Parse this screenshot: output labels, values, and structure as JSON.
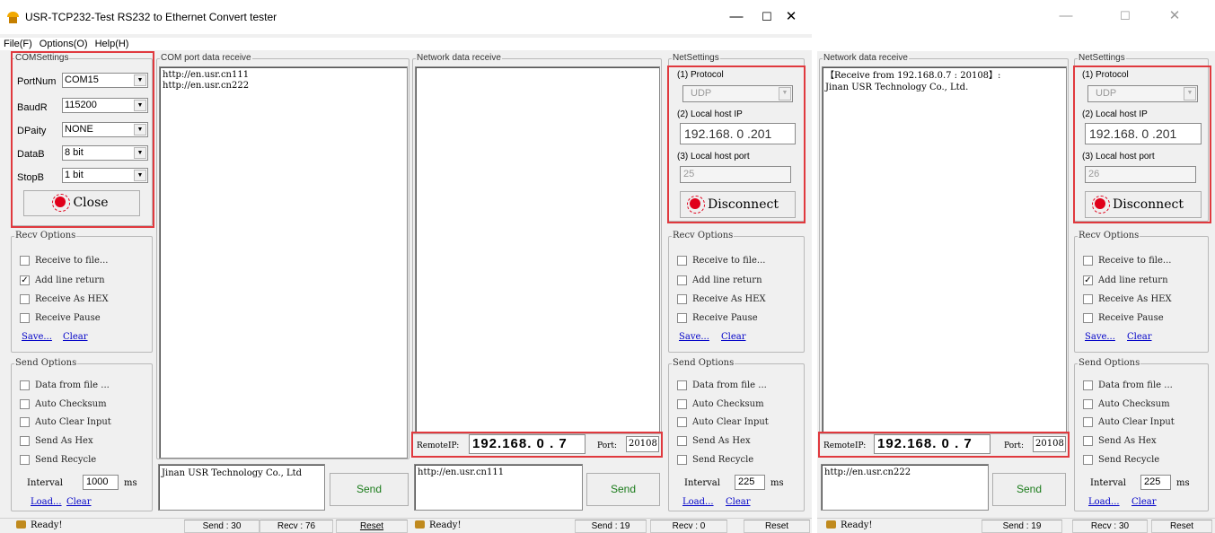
{
  "win1": {
    "title": "USR-TCP232-Test  RS232 to Ethernet Convert tester",
    "menu": [
      "File(F)",
      "Options(O)",
      "Help(H)"
    ],
    "com_settings": {
      "legend": "COMSettings",
      "port_label": "PortNum",
      "port_value": "COM15",
      "baud_label": "BaudR",
      "baud_value": "115200",
      "parity_label": "DPaity",
      "parity_value": "NONE",
      "data_label": "DataB",
      "data_value": "8 bit",
      "stop_label": "StopB",
      "stop_value": "1 bit",
      "close_btn": "Close"
    },
    "recv_options": {
      "legend": "Recv Options",
      "items": [
        "Receive to file...",
        "Add line return",
        "Receive As HEX",
        "Receive Pause"
      ],
      "checked": [
        false,
        true,
        false,
        false
      ],
      "save": "Save...",
      "clear": "Clear"
    },
    "send_options": {
      "legend": "Send Options",
      "items": [
        "Data from file ...",
        "Auto Checksum",
        "Auto Clear Input",
        "Send As Hex",
        "Send Recycle"
      ],
      "interval_label": "Interval",
      "interval_value": "1000",
      "interval_unit": "ms",
      "load": "Load...",
      "clear": "Clear"
    },
    "com_receive": {
      "legend": "COM port data receive",
      "lines": [
        "http://en.usr.cn111",
        "http://en.usr.cn222"
      ]
    },
    "com_send_text": "Jinan USR Technology Co., Ltd",
    "send_btn": "Send",
    "net_receive": {
      "legend": "Network data receive"
    },
    "remote_ip_label": "RemoteIP:",
    "remote_ip": "192.168. 0 . 7",
    "port_label": "Port:",
    "port_value": "20108",
    "net_send_text": "http://en.usr.cn111",
    "net_send_btn": "Send",
    "net_settings": {
      "legend": "NetSettings",
      "protocol_label": "(1) Protocol",
      "protocol": "UDP",
      "ip_label": "(2) Local host IP",
      "ip": "192.168. 0 .201",
      "port_label": "(3) Local host port",
      "port": "25",
      "disconnect": "Disconnect"
    },
    "net_recv_options": {
      "legend": "Recv Options",
      "items": [
        "Receive to file...",
        "Add line return",
        "Receive As HEX",
        "Receive Pause"
      ],
      "checked": [
        false,
        false,
        false,
        false
      ],
      "save": "Save...",
      "clear": "Clear"
    },
    "net_send_options": {
      "legend": "Send Options",
      "items": [
        "Data from file ...",
        "Auto Checksum",
        "Auto Clear Input",
        "Send As Hex",
        "Send Recycle"
      ],
      "interval_label": "Interval",
      "interval_value": "225",
      "interval_unit": "ms",
      "load": "Load...",
      "clear": "Clear"
    },
    "status": {
      "ready1": "Ready!",
      "send1": "Send : 30",
      "recv1": "Recv : 76",
      "reset1": "Reset",
      "ready2": "Ready!",
      "send2": "Send : 19",
      "recv2": "Recv : 0",
      "reset2": "Reset"
    }
  },
  "win2": {
    "net_receive": {
      "legend": "Network data receive",
      "line1": "【Receive from 192.168.0.7 : 20108】:",
      "line2": "Jinan USR Technology Co., Ltd."
    },
    "remote_ip_label": "RemoteIP:",
    "remote_ip": "192.168. 0 . 7",
    "port_label": "Port:",
    "port_value": "20108",
    "send_text": "http://en.usr.cn222",
    "send_btn": "Send",
    "net_settings": {
      "legend": "NetSettings",
      "protocol_label": "(1) Protocol",
      "protocol": "UDP",
      "ip_label": "(2) Local host IP",
      "ip": "192.168. 0 .201",
      "port_label": "(3) Local host port",
      "port": "26",
      "disconnect": "Disconnect"
    },
    "recv_options": {
      "legend": "Recv Options",
      "items": [
        "Receive to file...",
        "Add line return",
        "Receive As HEX",
        "Receive Pause"
      ],
      "checked": [
        false,
        true,
        false,
        false
      ],
      "save": "Save...",
      "clear": "Clear"
    },
    "send_options": {
      "legend": "Send Options",
      "items": [
        "Data from file ...",
        "Auto Checksum",
        "Auto Clear Input",
        "Send As Hex",
        "Send Recycle"
      ],
      "interval_label": "Interval",
      "interval_value": "225",
      "interval_unit": "ms",
      "load": "Load...",
      "clear": "Clear"
    },
    "status": {
      "ready": "Ready!",
      "send": "Send : 19",
      "recv": "Recv : 30",
      "reset": "Reset"
    }
  },
  "colors": {
    "highlight_box": "#e0393e",
    "led": "#e0001a",
    "link": "#0000c8"
  },
  "icons": {
    "app": "app-icon",
    "led": "led-indicator-icon",
    "ready": "ready-icon"
  }
}
